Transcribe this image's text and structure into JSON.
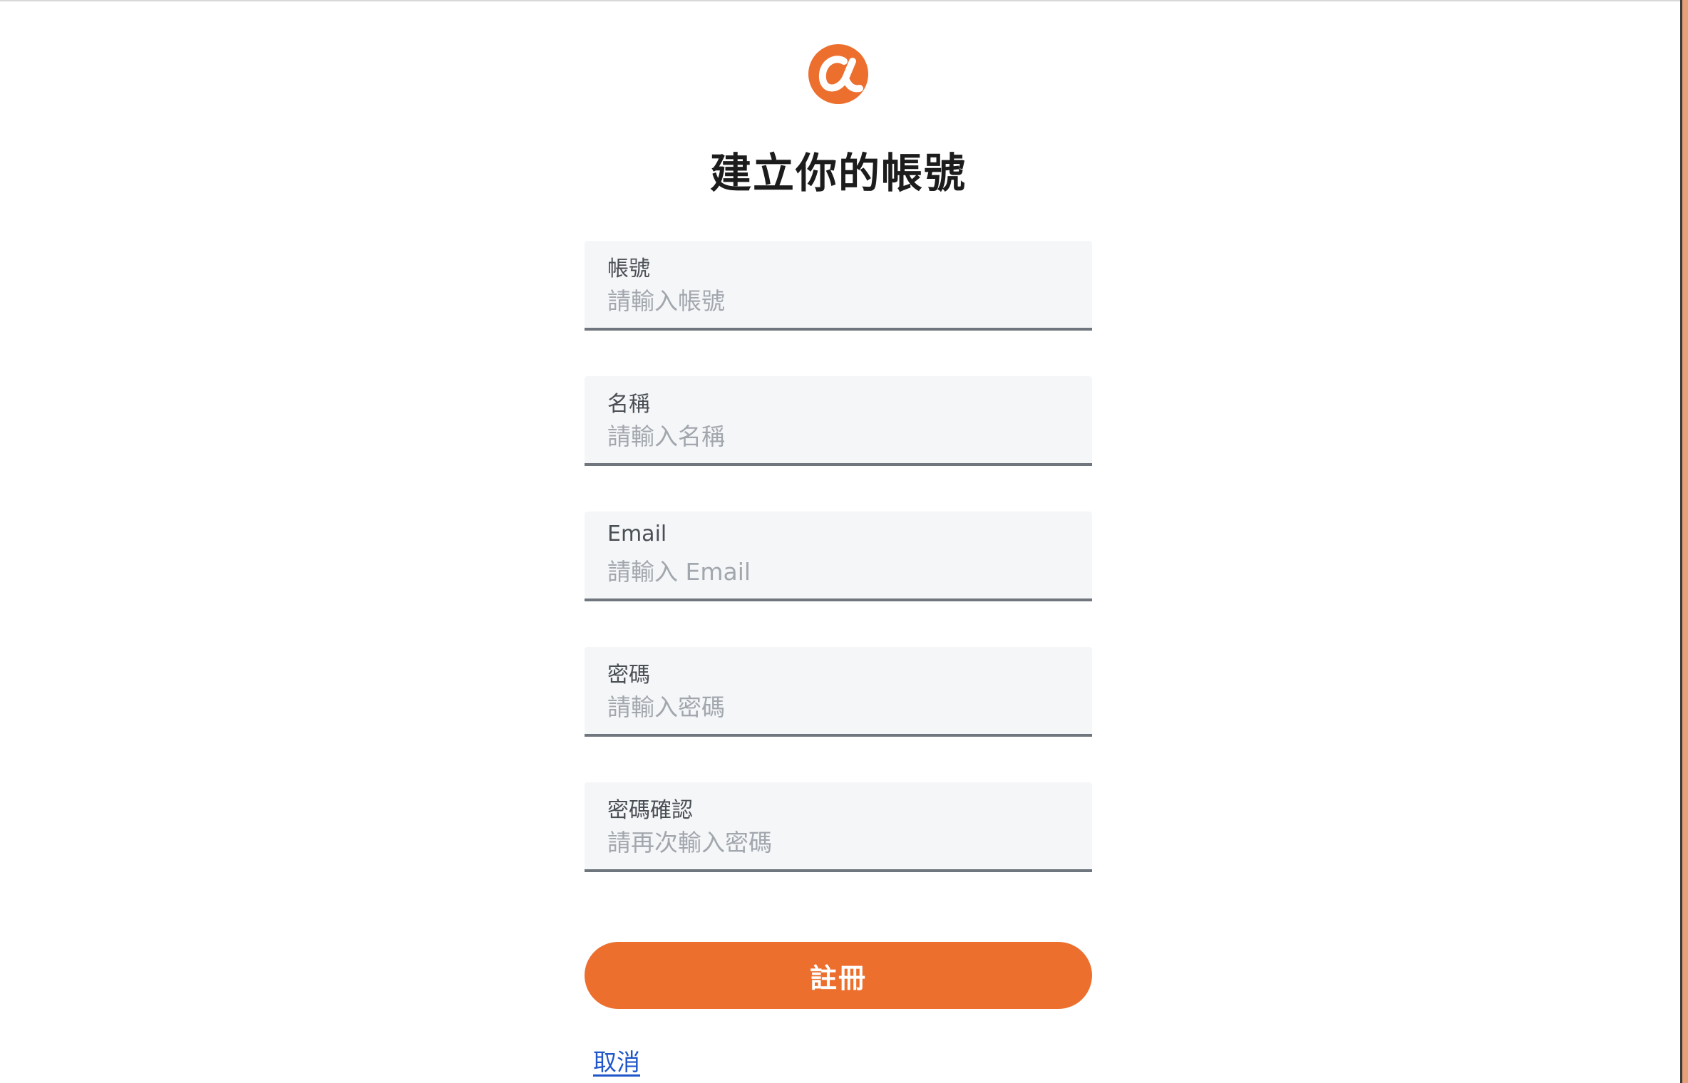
{
  "brand": {
    "logo_icon": "alpha-logo-icon",
    "accent_color": "#ec6f2e"
  },
  "page": {
    "title": "建立你的帳號"
  },
  "form": {
    "fields": [
      {
        "label": "帳號",
        "placeholder": "請輸入帳號",
        "value": ""
      },
      {
        "label": "名稱",
        "placeholder": "請輸入名稱",
        "value": ""
      },
      {
        "label": "Email",
        "placeholder": "請輸入 Email",
        "value": ""
      },
      {
        "label": "密碼",
        "placeholder": "請輸入密碼",
        "value": ""
      },
      {
        "label": "密碼確認",
        "placeholder": "請再次輸入密碼",
        "value": ""
      }
    ],
    "submit_label": "註冊",
    "cancel_label": "取消"
  }
}
